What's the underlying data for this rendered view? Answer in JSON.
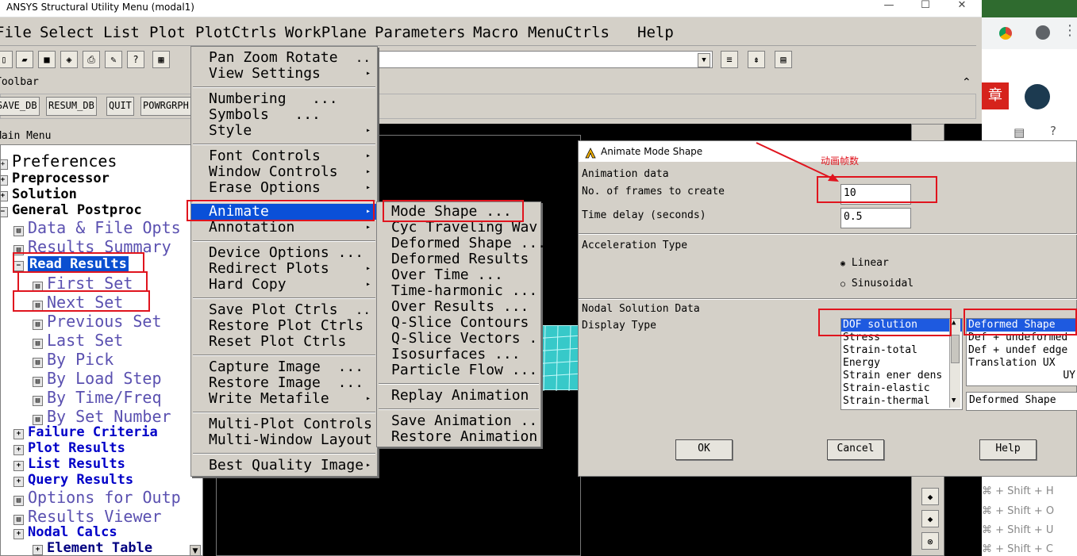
{
  "window": {
    "title": "ANSYS Structural Utility Menu (modal1)",
    "minimize": "—",
    "maximize": "☐",
    "close": "✕"
  },
  "menubar": [
    "File",
    "Select",
    "List",
    "Plot",
    "PlotCtrls",
    "WorkPlane",
    "Parameters",
    "Macro",
    "MenuCtrls",
    "Help"
  ],
  "toolbar": {
    "label": "Toolbar",
    "buttons": [
      "SAVE_DB",
      "RESUM_DB",
      "QUIT",
      "POWRGRPH"
    ]
  },
  "main_menu": {
    "label": "Main Menu",
    "items": [
      {
        "label": "Preferences"
      },
      {
        "label": "Preprocessor"
      },
      {
        "label": "Solution"
      },
      {
        "label": "General Postproc"
      },
      {
        "label": "Data & File Opts"
      },
      {
        "label": "Results Summary"
      },
      {
        "label": "Read Results"
      },
      {
        "label": "First Set"
      },
      {
        "label": "Next Set"
      },
      {
        "label": "Previous Set"
      },
      {
        "label": "Last Set"
      },
      {
        "label": "By Pick"
      },
      {
        "label": "By Load Step"
      },
      {
        "label": "By Time/Freq"
      },
      {
        "label": "By Set Number"
      },
      {
        "label": "Failure Criteria"
      },
      {
        "label": "Plot Results"
      },
      {
        "label": "List Results"
      },
      {
        "label": "Query Results"
      },
      {
        "label": "Options for Outp"
      },
      {
        "label": "Results Viewer"
      },
      {
        "label": "Nodal Calcs"
      },
      {
        "label": "Element Table"
      }
    ]
  },
  "plotctrls_menu": [
    {
      "label": "Pan Zoom Rotate",
      "suffix": ".."
    },
    {
      "label": "View Settings",
      "suffix": "▸"
    },
    {
      "label": "Numbering",
      "suffix": "..."
    },
    {
      "label": "Symbols",
      "suffix": "..."
    },
    {
      "label": "Style",
      "suffix": "▸"
    },
    {
      "label": "Font Controls",
      "suffix": "▸"
    },
    {
      "label": "Window Controls",
      "suffix": "▸"
    },
    {
      "label": "Erase Options",
      "suffix": "▸"
    },
    {
      "label": "Animate",
      "suffix": "▸"
    },
    {
      "label": "Annotation",
      "suffix": "▸"
    },
    {
      "label": "Device Options",
      "suffix": "..."
    },
    {
      "label": "Redirect Plots",
      "suffix": "▸"
    },
    {
      "label": "Hard Copy",
      "suffix": "▸"
    },
    {
      "label": "Save Plot Ctrls",
      "suffix": ".."
    },
    {
      "label": "Restore Plot Ctrls",
      "suffix": ""
    },
    {
      "label": "Reset Plot Ctrls",
      "suffix": ""
    },
    {
      "label": "Capture Image",
      "suffix": "..."
    },
    {
      "label": "Restore Image",
      "suffix": "..."
    },
    {
      "label": "Write Metafile",
      "suffix": "▸"
    },
    {
      "label": "Multi-Plot Controls",
      "suffix": ""
    },
    {
      "label": "Multi-Window Layout",
      "suffix": ""
    },
    {
      "label": "Best Quality Image",
      "suffix": "▸"
    }
  ],
  "animate_menu": [
    "Mode Shape ...",
    "Cyc Traveling Wav",
    "Deformed Shape ...",
    "Deformed Results",
    "Over Time ...",
    "Time-harmonic ...",
    "Over Results ...",
    "Q-Slice Contours",
    "Q-Slice Vectors .",
    "Isosurfaces ...",
    "Particle Flow ...",
    "Replay Animation",
    "Save Animation ..",
    "Restore Animation"
  ],
  "dialog": {
    "title": "Animate Mode Shape",
    "annotation": "动画帧数",
    "animation_data": "Animation data",
    "frames_label": "No. of frames to create",
    "frames_value": "10",
    "delay_label": "Time delay (seconds)",
    "delay_value": "0.5",
    "accel_label": "Acceleration Type",
    "linear": "Linear",
    "sinusoidal": "Sinusoidal",
    "nodal_label": "Nodal Solution Data",
    "display_type": "Display Type",
    "list1": [
      "DOF solution",
      "Stress",
      "Strain-total",
      "Energy",
      "Strain ener dens",
      "Strain-elastic",
      "Strain-thermal"
    ],
    "list2": [
      "Deformed Shape",
      "Def + undeformed",
      "Def + undef edge",
      "Translation   UX",
      "UY"
    ],
    "list2_value": "Deformed Shape",
    "ok": "OK",
    "cancel": "Cancel",
    "help": "Help"
  },
  "chrome": {
    "badge": "章",
    "shortcuts": [
      "⌘ + Shift + H",
      "⌘ + Shift + O",
      "⌘ + Shift + U",
      "⌘ + Shift + C"
    ]
  }
}
